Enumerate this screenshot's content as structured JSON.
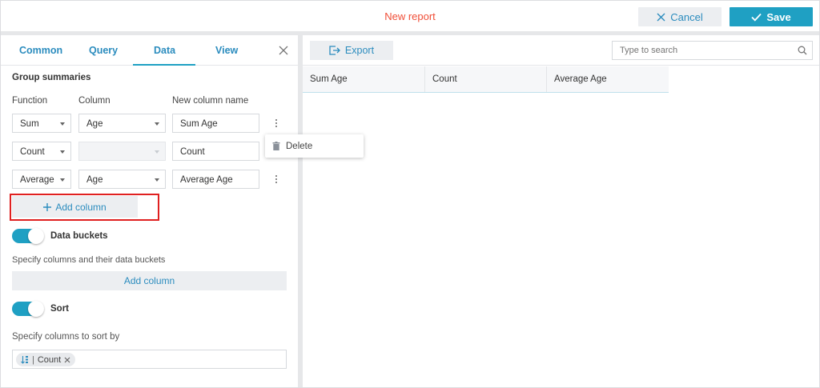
{
  "header": {
    "title": "New report",
    "cancel_label": "Cancel",
    "save_label": "Save"
  },
  "left_panel": {
    "tabs": [
      {
        "label": "Common"
      },
      {
        "label": "Query"
      },
      {
        "label": "Data",
        "active": true
      },
      {
        "label": "View"
      }
    ],
    "section_title": "Group summaries",
    "column_headers": {
      "function": "Function",
      "column": "Column",
      "new_name": "New column name"
    },
    "rows": [
      {
        "function": "Sum",
        "column": "Age",
        "new_name": "Sum Age"
      },
      {
        "function": "Count",
        "column": "",
        "new_name": "Count"
      },
      {
        "function": "Average",
        "column": "Age",
        "new_name": "Average Age"
      }
    ],
    "add_column_label": "Add column",
    "data_buckets": {
      "label": "Data buckets",
      "enabled": true,
      "hint": "Specify columns and their data buckets",
      "add_label": "Add column"
    },
    "sort": {
      "label": "Sort",
      "enabled": true,
      "hint": "Specify columns to sort by",
      "chips": [
        {
          "label": "Count"
        }
      ]
    }
  },
  "context_menu": {
    "items": [
      {
        "label": "Delete",
        "icon": "trash-icon"
      }
    ]
  },
  "right_panel": {
    "export_label": "Export",
    "search_placeholder": "Type to search",
    "grid_columns": [
      "Sum Age",
      "Count",
      "Average Age"
    ]
  },
  "colors": {
    "accent": "#1fa0c3",
    "link": "#2b8cbe",
    "title": "#f04e37",
    "highlight": "#e02020"
  }
}
